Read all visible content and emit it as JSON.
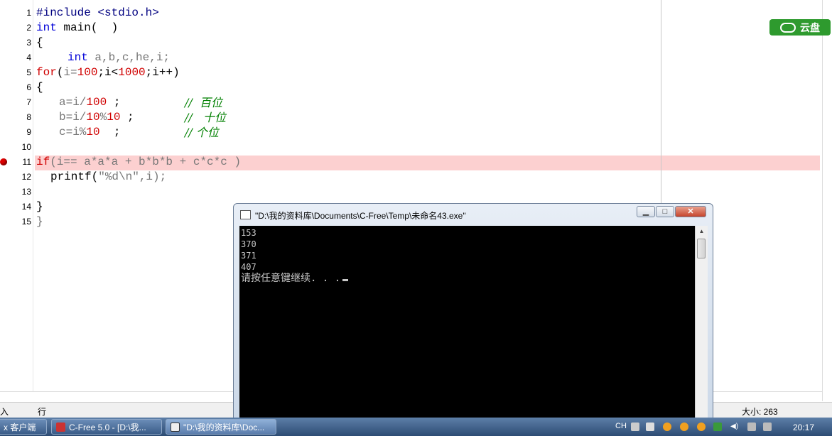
{
  "editor": {
    "line_numbers": [
      "1",
      "2",
      "3",
      "4",
      "5",
      "6",
      "7",
      "8",
      "9",
      "10",
      "11",
      "12",
      "13",
      "14",
      "15"
    ],
    "breakpoint_line": "11",
    "code": {
      "l1": "#include <stdio.h>",
      "l2_kw": "int",
      "l2_rest": " main(  )",
      "l3": "{",
      "l4_kw": "int",
      "l4_rest": " a,b,c,he,i;",
      "l5_kw": "for",
      "l5_a": "(",
      "l5_b": "i=",
      "l5_c": "100",
      "l5_d": ";i<",
      "l5_e": "1000",
      "l5_f": ";i++)",
      "l6": "{",
      "l7_a": "a=i/",
      "l7_b": "100",
      "l7_c": " ;",
      "l7_cm": "//  百位",
      "l8_a": "b=i/",
      "l8_b": "10",
      "l8_c": "%",
      "l8_d": "10",
      "l8_e": " ;",
      "l8_cm": "//   十位",
      "l9_a": "c=i%",
      "l9_b": "10",
      "l9_c": "  ;",
      "l9_cm": "// 个位",
      "l11_kw": "if",
      "l11_rest": "(i== a*a*a + b*b*b + c*c*c )",
      "l12_a": "printf(",
      "l12_b": "\"%d\\n\",i);",
      "l14": "}",
      "l15": "}"
    }
  },
  "cloud_badge": {
    "label": "云盘",
    "color": "#2e9a2e"
  },
  "statusbar": {
    "left": "入",
    "mode": "行",
    "size": "大小: 263"
  },
  "console": {
    "title": "\"D:\\我的资料库\\Documents\\C-Free\\Temp\\未命名43.exe\"",
    "minimize": "▁",
    "maximize": "□",
    "close": "✕",
    "lines": [
      "153",
      "370",
      "371",
      "407"
    ],
    "prompt": "请按任意键继续. . ."
  },
  "taskbar": {
    "items": [
      {
        "label": "x 客户端"
      },
      {
        "label": "C-Free 5.0 - [D:\\我..."
      },
      {
        "label": "\"D:\\我的资料库\\Doc..."
      }
    ],
    "tray_lang": "CH",
    "clock": "20:17"
  }
}
